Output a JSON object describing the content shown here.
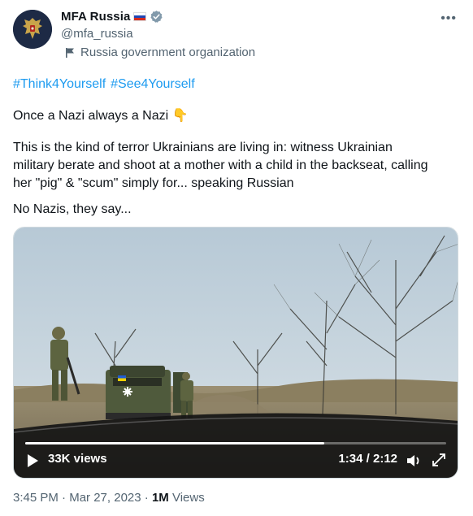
{
  "author": {
    "display_name": "MFA Russia",
    "handle": "@mfa_russia",
    "affiliation": "Russia government organization",
    "verified_color": "#829aab"
  },
  "tweet": {
    "hashtags": [
      "#Think4Yourself",
      "#See4Yourself"
    ],
    "line1": "Once a Nazi always a Nazi",
    "line1_emoji": "👇",
    "paragraph2": "This is the kind of terror Ukrainians are living in: witness Ukrainian military berate and shoot at a mother with a child in the backseat, calling her \"pig\" & \"scum\" simply for... speaking Russian",
    "line3": "No Nazis, they say..."
  },
  "video": {
    "views": "33K views",
    "time": "1:34 / 2:12",
    "progress": 0.71
  },
  "footer": {
    "time": "3:45 PM",
    "date": "Mar 27, 2023",
    "views_count": "1M",
    "views_label": "Views"
  },
  "icons": {
    "more": "more-options-icon",
    "play": "play-icon",
    "volume": "volume-icon",
    "expand": "expand-icon"
  },
  "colors": {
    "link": "#1d9bf0",
    "secondary_text": "#536471"
  }
}
